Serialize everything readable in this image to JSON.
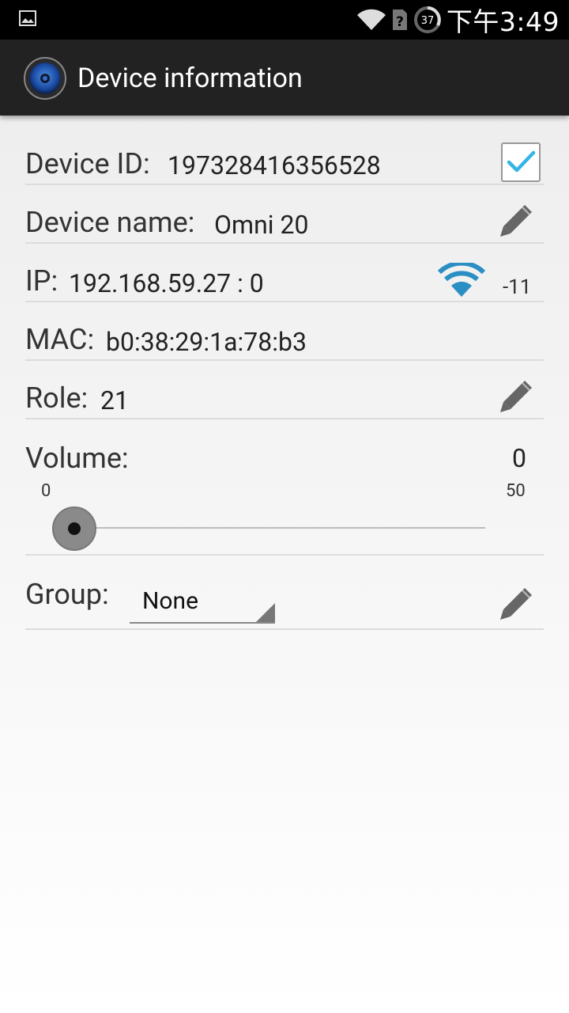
{
  "status_bar": {
    "time": "下午3:49",
    "battery_level": "37",
    "icons": [
      "gallery-icon",
      "wifi-icon",
      "sim-unknown-icon",
      "battery-icon"
    ]
  },
  "action_bar": {
    "title": "Device information",
    "icon": "speaker-app-icon"
  },
  "fields": {
    "device_id": {
      "label": "Device ID:",
      "value": "197328416356528",
      "checked": true
    },
    "device_name": {
      "label": "Device name:",
      "value": "Omni 20"
    },
    "ip": {
      "label": "IP:",
      "value": "192.168.59.27 : 0",
      "signal": "-11"
    },
    "mac": {
      "label": "MAC:",
      "value": "b0:38:29:1a:78:b3"
    },
    "role": {
      "label": "Role:",
      "value": "21"
    },
    "volume": {
      "label": "Volume:",
      "value": "0",
      "min": "0",
      "max": "50"
    },
    "group": {
      "label": "Group:",
      "selected": "None"
    }
  },
  "colors": {
    "accent": "#33b5e5",
    "wifi": "#2b8fc4",
    "action_bar": "#222222",
    "status_bar": "#000000"
  }
}
